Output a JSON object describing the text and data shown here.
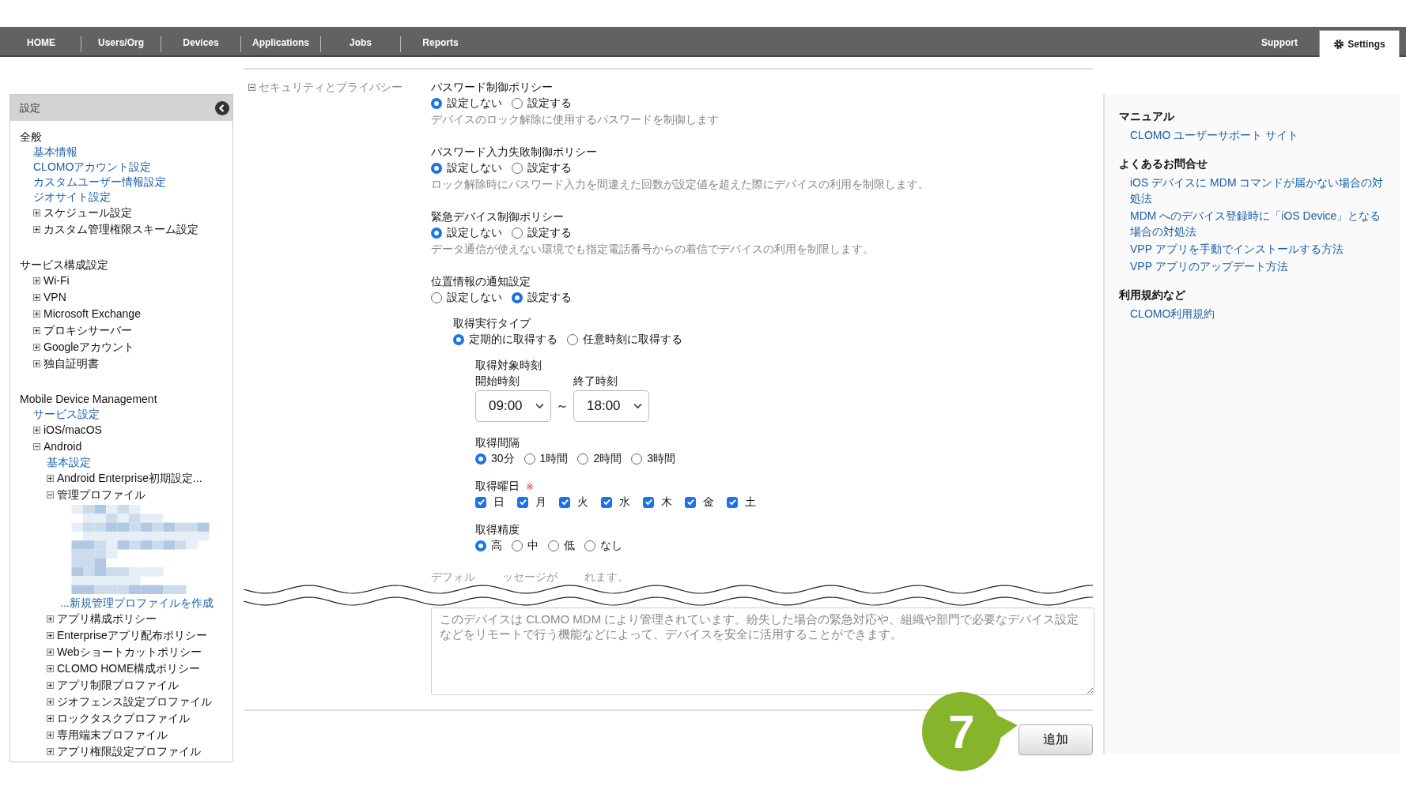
{
  "nav": {
    "left_tabs": [
      {
        "label": "HOME",
        "selected": false
      },
      {
        "label": "Users/Org",
        "selected": false
      },
      {
        "label": "Devices",
        "selected": false
      },
      {
        "label": "Applications",
        "selected": false
      },
      {
        "label": "Jobs",
        "selected": false
      },
      {
        "label": "Reports",
        "selected": false
      }
    ],
    "right_tabs": [
      {
        "kind": "plain",
        "label": "Support",
        "selected": false
      },
      {
        "kind": "with_icon",
        "label": "Settings",
        "selected": true
      }
    ]
  },
  "sidebar": {
    "title": "設定",
    "sections": [
      {
        "title": "全般",
        "items": [
          {
            "kind": "link",
            "label": "基本情報"
          },
          {
            "kind": "link",
            "label": "CLOMOアカウント設定"
          },
          {
            "kind": "link",
            "label": "カスタムユーザー情報設定"
          },
          {
            "kind": "link",
            "label": "ジオサイト設定"
          },
          {
            "kind": "node",
            "label": "スケジュール設定",
            "expanded": false
          },
          {
            "kind": "node",
            "label": "カスタム管理権限スキーム設定",
            "expanded": false
          }
        ]
      },
      {
        "title": "サービス構成設定",
        "items": [
          {
            "kind": "node",
            "label": "Wi-Fi",
            "expanded": false
          },
          {
            "kind": "node",
            "label": "VPN",
            "expanded": false
          },
          {
            "kind": "node",
            "label": "Microsoft Exchange",
            "expanded": false
          },
          {
            "kind": "node",
            "label": "プロキシサーバー",
            "expanded": false
          },
          {
            "kind": "node",
            "label": "Googleアカウント",
            "expanded": false
          },
          {
            "kind": "node",
            "label": "独自証明書",
            "expanded": false
          }
        ]
      },
      {
        "title": "Mobile Device Management",
        "items": [
          {
            "kind": "link",
            "label": "サービス設定"
          },
          {
            "kind": "node",
            "label": "iOS/macOS",
            "expanded": false
          },
          {
            "kind": "node",
            "label": "Android",
            "expanded": true,
            "children": [
              {
                "kind": "link",
                "label": "基本設定"
              },
              {
                "kind": "node",
                "label": "Android Enterprise初期設定...",
                "expanded": false
              },
              {
                "kind": "node",
                "label": "管理プロファイル",
                "expanded": true,
                "children": [
                  {
                    "kind": "redacted"
                  },
                  {
                    "kind": "link",
                    "label": "...新規管理プロファイルを作成"
                  }
                ]
              },
              {
                "kind": "node",
                "label": "アプリ構成ポリシー",
                "expanded": false
              },
              {
                "kind": "node",
                "label": "Enterpriseアプリ配布ポリシー",
                "expanded": false
              },
              {
                "kind": "node",
                "label": "Webショートカットポリシー",
                "expanded": false
              },
              {
                "kind": "node",
                "label": "CLOMO HOME構成ポリシー",
                "expanded": false
              },
              {
                "kind": "node",
                "label": "アプリ制限プロファイル",
                "expanded": false
              },
              {
                "kind": "node",
                "label": "ジオフェンス設定プロファイル",
                "expanded": false
              },
              {
                "kind": "node",
                "label": "ロックタスクプロファイル",
                "expanded": false
              },
              {
                "kind": "node",
                "label": "専用端末プロファイル",
                "expanded": false
              },
              {
                "kind": "node",
                "label": "アプリ権限設定プロファイル",
                "expanded": false
              }
            ]
          }
        ]
      }
    ]
  },
  "content": {
    "section": {
      "label": "セキュリティとプライバシー",
      "expanded": true
    },
    "policies": [
      {
        "kind": "radio",
        "title": "パスワード制御ポリシー",
        "options": [
          {
            "label": "設定しない",
            "selected": true
          },
          {
            "label": "設定する",
            "selected": false
          }
        ],
        "description": "デバイスのロック解除に使用するパスワードを制御します"
      },
      {
        "kind": "radio",
        "title": "パスワード入力失敗制御ポリシー",
        "options": [
          {
            "label": "設定しない",
            "selected": true
          },
          {
            "label": "設定する",
            "selected": false
          }
        ],
        "description": "ロック解除時にパスワード入力を間違えた回数が設定値を超えた際にデバイスの利用を制限します。"
      },
      {
        "kind": "radio",
        "title": "緊急デバイス制御ポリシー",
        "options": [
          {
            "label": "設定しない",
            "selected": true
          },
          {
            "label": "設定する",
            "selected": false
          }
        ],
        "description": "データ通信が使えない環境でも指定電話番号からの着信でデバイスの利用を制限します。"
      },
      {
        "kind": "radio",
        "title": "位置情報の通知設定",
        "options": [
          {
            "label": "設定しない",
            "selected": false
          },
          {
            "label": "設定する",
            "selected": true
          }
        ],
        "children": [
          {
            "kind": "radio",
            "title": "取得実行タイプ",
            "options": [
              {
                "label": "定期的に取得する",
                "selected": true
              },
              {
                "label": "任意時刻に取得する",
                "selected": false
              }
            ],
            "children": [
              {
                "kind": "time_range",
                "title": "取得対象時刻",
                "start": {
                  "label": "開始時刻",
                  "value": "09:00"
                },
                "separator": "～",
                "end": {
                  "label": "終了時刻",
                  "value": "18:00"
                }
              },
              {
                "kind": "radio",
                "title": "取得間隔",
                "options": [
                  {
                    "label": "30分",
                    "selected": true
                  },
                  {
                    "label": "1時間",
                    "selected": false
                  },
                  {
                    "label": "2時間",
                    "selected": false
                  },
                  {
                    "label": "3時間",
                    "selected": false
                  }
                ]
              },
              {
                "kind": "checkbox",
                "title": "取得曜日",
                "required_mark": "※",
                "options": [
                  {
                    "label": "日",
                    "checked": true
                  },
                  {
                    "label": "月",
                    "checked": true
                  },
                  {
                    "label": "火",
                    "checked": true
                  },
                  {
                    "label": "水",
                    "checked": true
                  },
                  {
                    "label": "木",
                    "checked": true
                  },
                  {
                    "label": "金",
                    "checked": true
                  },
                  {
                    "label": "土",
                    "checked": true
                  }
                ]
              },
              {
                "kind": "radio",
                "title": "取得精度",
                "options": [
                  {
                    "label": "高",
                    "selected": true
                  },
                  {
                    "label": "中",
                    "selected": false
                  },
                  {
                    "label": "低",
                    "selected": false
                  },
                  {
                    "label": "なし",
                    "selected": false
                  }
                ]
              }
            ]
          }
        ]
      }
    ],
    "hint_fragments": [
      "デフォル",
      "ッセージが",
      "れます。"
    ],
    "message": "このデバイスは CLOMO MDM により管理されています。紛失した場合の緊急対応や、組織や部門で必要なデバイス設定などをリモートで行う機能などによって、デバイスを安全に活用することができます。",
    "submit": "追加",
    "step_badge": "7"
  },
  "help": {
    "groups": [
      {
        "title": "マニュアル",
        "links": [
          "CLOMO ユーザーサポート サイト"
        ]
      },
      {
        "title": "よくあるお問合せ",
        "links": [
          "iOS デバイスに MDM コマンドが届かない場合の対処法",
          "MDM へのデバイス登録時に「iOS Device」となる場合の対処法",
          "VPP アプリを手動でインストールする方法",
          "VPP アプリのアップデート方法"
        ]
      },
      {
        "title": "利用規約など",
        "links": [
          "CLOMO利用規約"
        ]
      }
    ]
  }
}
